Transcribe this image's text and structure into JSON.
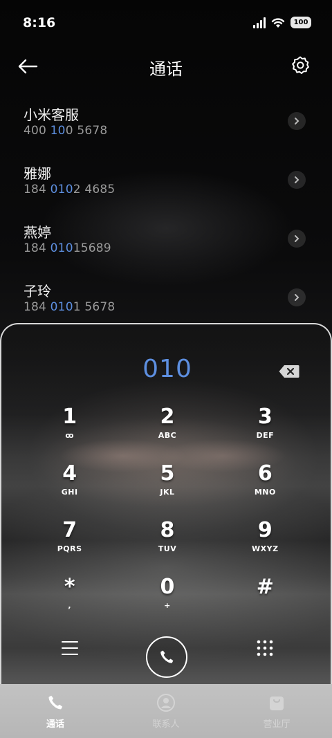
{
  "status_bar": {
    "time": "8:16",
    "battery": "100"
  },
  "header": {
    "title": "通话"
  },
  "contacts": [
    {
      "name": "小米客服",
      "num_pre": "400 ",
      "num_hl": "10",
      "num_post": "0 5678"
    },
    {
      "name": "雅娜",
      "num_pre": "184 ",
      "num_hl": "010",
      "num_post": "2 4685"
    },
    {
      "name": "燕婷",
      "num_pre": "184 ",
      "num_hl": "010",
      "num_post": "15689"
    },
    {
      "name": "子玲",
      "num_pre": "184 ",
      "num_hl": "010",
      "num_post": "1 5678"
    }
  ],
  "dialpad": {
    "digits": "010",
    "keys": [
      {
        "num": "1",
        "sub": "ꝏ"
      },
      {
        "num": "2",
        "sub": "ABC"
      },
      {
        "num": "3",
        "sub": "DEF"
      },
      {
        "num": "4",
        "sub": "GHI"
      },
      {
        "num": "5",
        "sub": "JKL"
      },
      {
        "num": "6",
        "sub": "MNO"
      },
      {
        "num": "7",
        "sub": "PQRS"
      },
      {
        "num": "8",
        "sub": "TUV"
      },
      {
        "num": "9",
        "sub": "WXYZ"
      },
      {
        "num": "*",
        "sub": ","
      },
      {
        "num": "0",
        "sub": "+"
      },
      {
        "num": "#",
        "sub": ""
      }
    ]
  },
  "tabs": [
    {
      "label": "通话",
      "icon": "phone-icon",
      "active": true
    },
    {
      "label": "联系人",
      "icon": "person-icon",
      "active": false
    },
    {
      "label": "营业厅",
      "icon": "shop-bag-icon",
      "active": false
    }
  ],
  "colors": {
    "highlight": "#5d8fe0",
    "tabbar": "#bdbdbd"
  }
}
